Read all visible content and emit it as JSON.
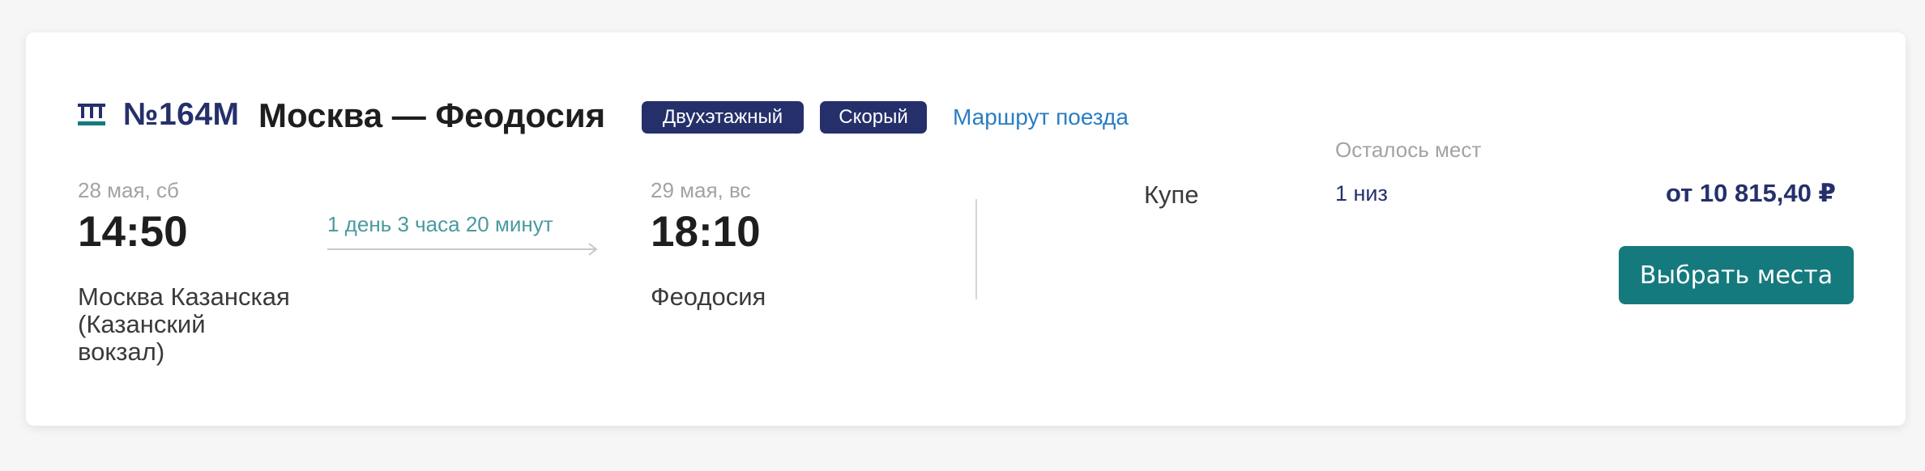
{
  "train": {
    "icon": "train-icon",
    "number": "№164М",
    "route": "Москва — Феодосия",
    "badges": [
      "Двухэтажный",
      "Скорый"
    ],
    "route_link": "Маршрут поезда"
  },
  "departure": {
    "date": "28 мая, сб",
    "time": "14:50",
    "station_lines": [
      "Москва Казанская",
      "(Казанский",
      "вокзал)"
    ]
  },
  "duration": "1 день 3 часа 20 минут",
  "arrival": {
    "date": "29 мая, вс",
    "time": "18:10",
    "station": "Феодосия"
  },
  "offer": {
    "car_type": "Купе",
    "seats_title": "Осталось мест",
    "seats_value": "1 низ",
    "price": "от 10 815,40 ₽",
    "button_label": "Выбрать места"
  },
  "colors": {
    "brand_navy": "#25306b",
    "accent_teal": "#157a7d",
    "link_blue": "#2a7dc2",
    "duration_teal": "#4a9a9f",
    "background": "#f6f6f6"
  }
}
